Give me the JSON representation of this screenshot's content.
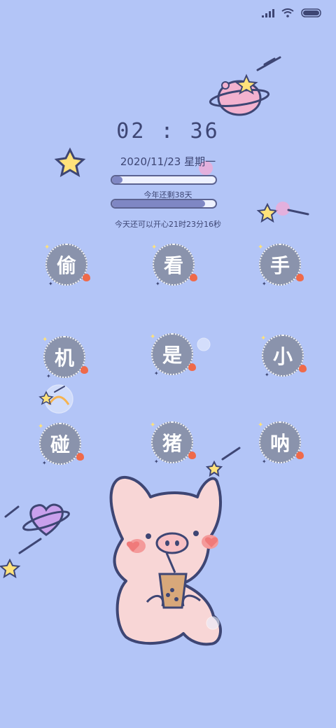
{
  "clock": {
    "time": "02 : 36"
  },
  "date": {
    "text": "2020/11/23 星期一"
  },
  "year_progress": {
    "remaining_label": "今年还剩38天",
    "progress": 0.9
  },
  "day_progress": {
    "progress": 0.1
  },
  "countdown": {
    "text": "今天还可以开心21时23分16秒"
  },
  "apps": [
    {
      "char": "偷"
    },
    {
      "char": "看"
    },
    {
      "char": "手"
    },
    {
      "char": "机"
    },
    {
      "char": "是"
    },
    {
      "char": "小"
    },
    {
      "char": "碰"
    },
    {
      "char": "猪"
    },
    {
      "char": "呐"
    }
  ],
  "colors": {
    "background": "#b3c5f7",
    "text": "#3e4674",
    "icon_bg": "#8a93ac",
    "pig": "#f8d6d6"
  }
}
